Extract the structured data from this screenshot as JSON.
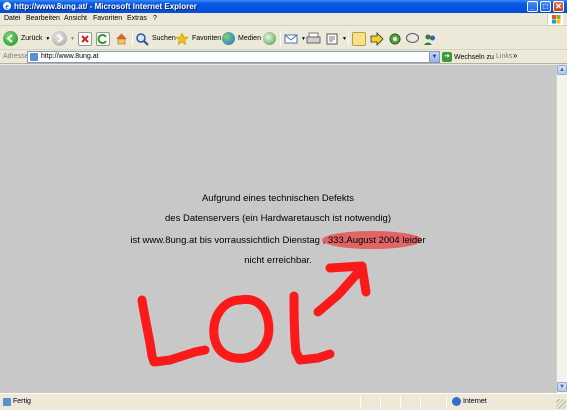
{
  "window": {
    "title": "http://www.8ung.at/ - Microsoft Internet Explorer",
    "minimize": "_",
    "maximize": "□",
    "close": "✕"
  },
  "menu": {
    "items": [
      "Datei",
      "Bearbeiten",
      "Ansicht",
      "Favoriten",
      "Extras",
      "?"
    ]
  },
  "toolbar": {
    "back_label": "Zurück",
    "search_label": "Suchen",
    "favorites_label": "Favoriten",
    "media_label": "Medien"
  },
  "address": {
    "label": "Adresse",
    "url": "http://www.8ung.at",
    "go_label": "Wechseln zu",
    "links_label": "Links",
    "links_chevron": "»"
  },
  "content": {
    "line1": "Aufgrund eines technischen Defekts",
    "line2": "des Datenservers (ein Hardwaretausch ist notwendig)",
    "line3": "ist www.8ung.at bis vorraussichtlich Dienstag , 333.August 2004 leider",
    "line4": "nicht erreichbar.",
    "highlight_color": "#e84646",
    "scribble_text": "LOL",
    "scribble_color": "#ff1010"
  },
  "status": {
    "text": "Fertig",
    "zone": "Internet"
  }
}
